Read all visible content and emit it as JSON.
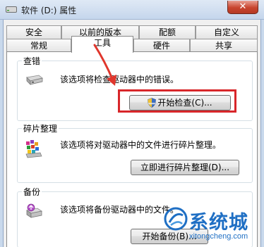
{
  "window": {
    "title": "软件 (D:) 属性",
    "close_label": "✕"
  },
  "tabs": {
    "top_row": [
      "安全",
      "以前的版本",
      "配额",
      "自定义"
    ],
    "bottom_row": [
      "常规",
      "工具",
      "硬件",
      "共享"
    ],
    "active": "工具"
  },
  "sections": {
    "error_check": {
      "title": "查错",
      "description": "该选项将检查驱动器中的错误。",
      "button_label": "开始检查(C)..."
    },
    "defrag": {
      "title": "碎片整理",
      "description": "该选项将对驱动器中的文件进行碎片整理。",
      "button_label": "立即进行碎片整理(D)..."
    },
    "backup": {
      "title": "备份",
      "description": "该选项将备份驱动器中的文件。",
      "button_label": "开始备份(B)..."
    }
  },
  "annotation": {
    "highlight_color": "#d8262a"
  },
  "watermark": {
    "brand": "系统城",
    "url": "xitongcheng.com"
  },
  "colors": {
    "accent": "#1f6fc4",
    "close_button": "#c8452f"
  }
}
